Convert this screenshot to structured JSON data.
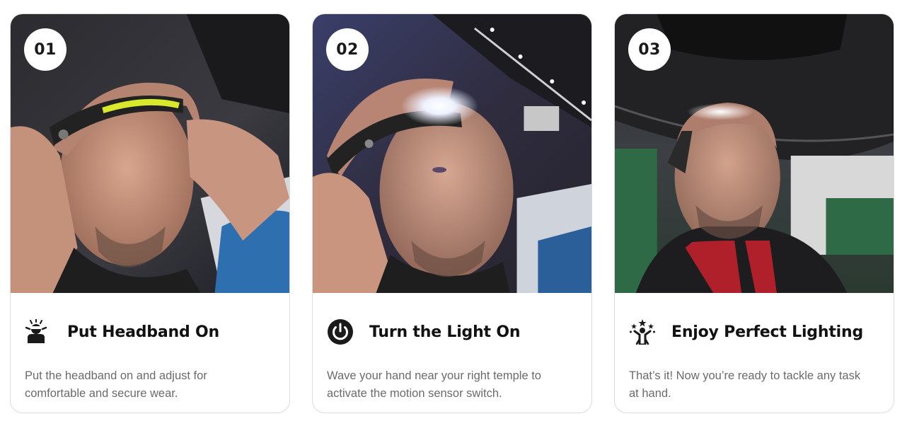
{
  "cards": [
    {
      "step": "01",
      "icon": "headband-person-icon",
      "title": "Put Headband On",
      "description": "Put the headband on and adjust for comfortable and secure wear.",
      "image": "man-putting-on-headlamp-photo"
    },
    {
      "step": "02",
      "icon": "power-button-icon",
      "title": "Turn the Light On",
      "description": "Wave your hand near your right temple to activate the motion sensor switch.",
      "image": "man-with-headlamp-on-photo"
    },
    {
      "step": "03",
      "icon": "sparkle-person-icon",
      "title": "Enjoy Perfect Lighting",
      "description": "That’s it! Now you’re ready to tackle any task at hand.",
      "image": "man-under-car-with-headlamp-photo"
    }
  ],
  "colors": {
    "accent_band": "#d9ea2c",
    "text_dark": "#111111",
    "text_muted": "#6b6b6b",
    "card_border": "#dcdcdc"
  }
}
